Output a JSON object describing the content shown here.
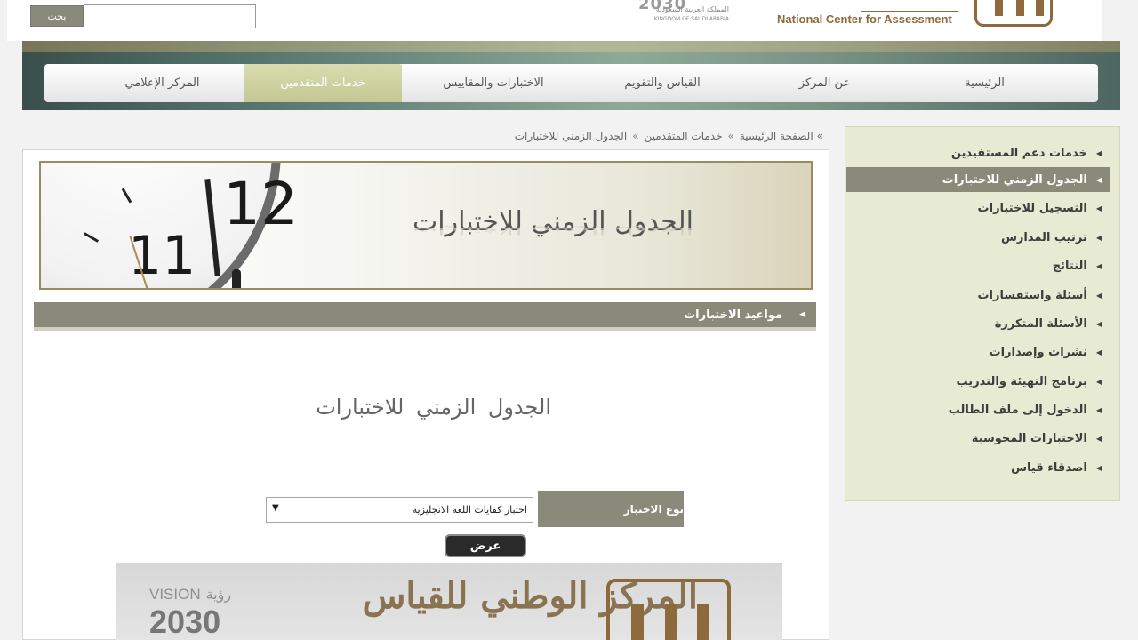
{
  "header": {
    "search_button": "بحث",
    "search_placeholder": "",
    "vision_ar": "المملكة العربية السعودية",
    "vision_en": "KINGDOM OF SAUDI ARABIA",
    "vision_year": "2030",
    "org_name_en": "National Center for Assessment"
  },
  "nav": {
    "items": [
      {
        "label": "الرئيسية",
        "active": false
      },
      {
        "label": "عن المركز",
        "active": false
      },
      {
        "label": "القياس والتقويم",
        "active": false
      },
      {
        "label": "الاختبارات والمقاييس",
        "active": false
      },
      {
        "label": "خدمات المتقدمين",
        "active": true
      },
      {
        "label": "المركز الإعلامي",
        "active": false
      }
    ]
  },
  "breadcrumb": {
    "items": [
      "الصفحة الرئيسية",
      "خدمات المتقدمين",
      "الجدول الزمني للاختبارات"
    ],
    "separator": "»"
  },
  "hero": {
    "title": "الجدول الزمني للاختبارات",
    "clock_numbers": [
      "12",
      "11"
    ]
  },
  "section": {
    "title": "مواعيد الاختبارات"
  },
  "page": {
    "title": "الجدول الزمني للاختبارات"
  },
  "form": {
    "label": "نوع الاختبار",
    "selected_value": "اختبار كفايات اللغة الانجليزية",
    "submit_label": "عرض"
  },
  "sidebar": {
    "items": [
      {
        "label": "خدمات دعم المستفيدين",
        "active": false
      },
      {
        "label": "الجدول الزمني للاختبارات",
        "active": true
      },
      {
        "label": "التسجيل للاختبارات",
        "active": false
      },
      {
        "label": "ترتيب المدارس",
        "active": false
      },
      {
        "label": "النتائج",
        "active": false
      },
      {
        "label": "أسئلة واستفسارات",
        "active": false
      },
      {
        "label": "الأسئلة المتكررة",
        "active": false
      },
      {
        "label": "نشرات وإصدارات",
        "active": false
      },
      {
        "label": "برنامج التهيئة والتدريب",
        "active": false
      },
      {
        "label": "الدخول إلى ملف الطالب",
        "active": false
      },
      {
        "label": "الاختبارات المحوسبة",
        "active": false
      },
      {
        "label": "اصدقاء قياس",
        "active": false
      }
    ]
  },
  "footer_banner": {
    "vision_en": "VISION",
    "vision_ar": "رؤية",
    "vision_year": "2030",
    "calligraphy": "المركز الوطني للقياس"
  },
  "colors": {
    "accent_gray": "#8a8a7a",
    "sidebar_bg": "#e8ebd3",
    "active_tab": "#c4c792",
    "brand_brown": "#8c6a3c"
  }
}
